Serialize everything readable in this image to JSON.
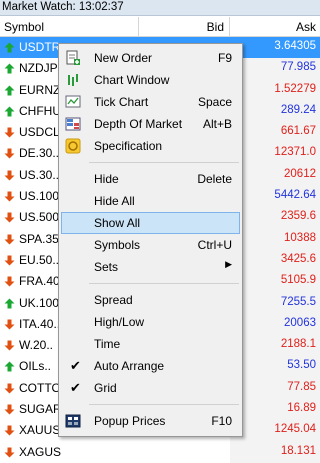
{
  "window": {
    "title": "Market Watch: 13:02:37"
  },
  "columns": {
    "symbol": "Symbol",
    "bid": "Bid",
    "ask": "Ask"
  },
  "rows": [
    {
      "symbol": "USDTR",
      "ask": "3.64305",
      "dir": "up",
      "color": "white",
      "selected": true
    },
    {
      "symbol": "NZDJP",
      "ask": "77.985",
      "dir": "up",
      "color": "blue"
    },
    {
      "symbol": "EURNZ",
      "ask": "1.52279",
      "dir": "up",
      "color": "red"
    },
    {
      "symbol": "CHFHU",
      "ask": "289.24",
      "dir": "up",
      "color": "blue"
    },
    {
      "symbol": "USDCL",
      "ask": "661.67",
      "dir": "down",
      "color": "red"
    },
    {
      "symbol": "DE.30..",
      "ask": "12371.0",
      "dir": "down",
      "color": "red"
    },
    {
      "symbol": "US.30..",
      "ask": "20612",
      "dir": "down",
      "color": "red"
    },
    {
      "symbol": "US.100",
      "ask": "5442.64",
      "dir": "down",
      "color": "blue"
    },
    {
      "symbol": "US.500",
      "ask": "2359.6",
      "dir": "down",
      "color": "red"
    },
    {
      "symbol": "SPA.35",
      "ask": "10388",
      "dir": "down",
      "color": "red"
    },
    {
      "symbol": "EU.50..",
      "ask": "3425.6",
      "dir": "down",
      "color": "red"
    },
    {
      "symbol": "FRA.40",
      "ask": "5105.9",
      "dir": "down",
      "color": "red"
    },
    {
      "symbol": "UK.100",
      "ask": "7255.5",
      "dir": "up",
      "color": "blue"
    },
    {
      "symbol": "ITA.40..",
      "ask": "20063",
      "dir": "down",
      "color": "blue"
    },
    {
      "symbol": "W.20..",
      "ask": "2188.1",
      "dir": "down",
      "color": "red"
    },
    {
      "symbol": "OILs..",
      "ask": "53.50",
      "dir": "up",
      "color": "blue"
    },
    {
      "symbol": "COTTO",
      "ask": "77.85",
      "dir": "down",
      "color": "red"
    },
    {
      "symbol": "SUGAR",
      "ask": "16.89",
      "dir": "down",
      "color": "red"
    },
    {
      "symbol": "XAUUS",
      "ask": "1245.04",
      "dir": "down",
      "color": "red"
    },
    {
      "symbol": "XAGUS",
      "ask": "18.131",
      "dir": "down",
      "color": "red"
    }
  ],
  "menu": {
    "new_order": "New Order",
    "new_order_sc": "F9",
    "chart_window": "Chart Window",
    "tick_chart": "Tick Chart",
    "tick_chart_sc": "Space",
    "depth": "Depth Of Market",
    "depth_sc": "Alt+B",
    "specification": "Specification",
    "hide": "Hide",
    "hide_sc": "Delete",
    "hide_all": "Hide All",
    "show_all": "Show All",
    "symbols": "Symbols",
    "symbols_sc": "Ctrl+U",
    "sets": "Sets",
    "spread": "Spread",
    "highlow": "High/Low",
    "time": "Time",
    "auto_arrange": "Auto Arrange",
    "grid": "Grid",
    "popup_prices": "Popup Prices",
    "popup_prices_sc": "F10"
  },
  "colors": {
    "up": "#1aa832",
    "down": "#e05010",
    "blue": "#2233dd",
    "red": "#e0201a",
    "selected": "#3399ff"
  }
}
